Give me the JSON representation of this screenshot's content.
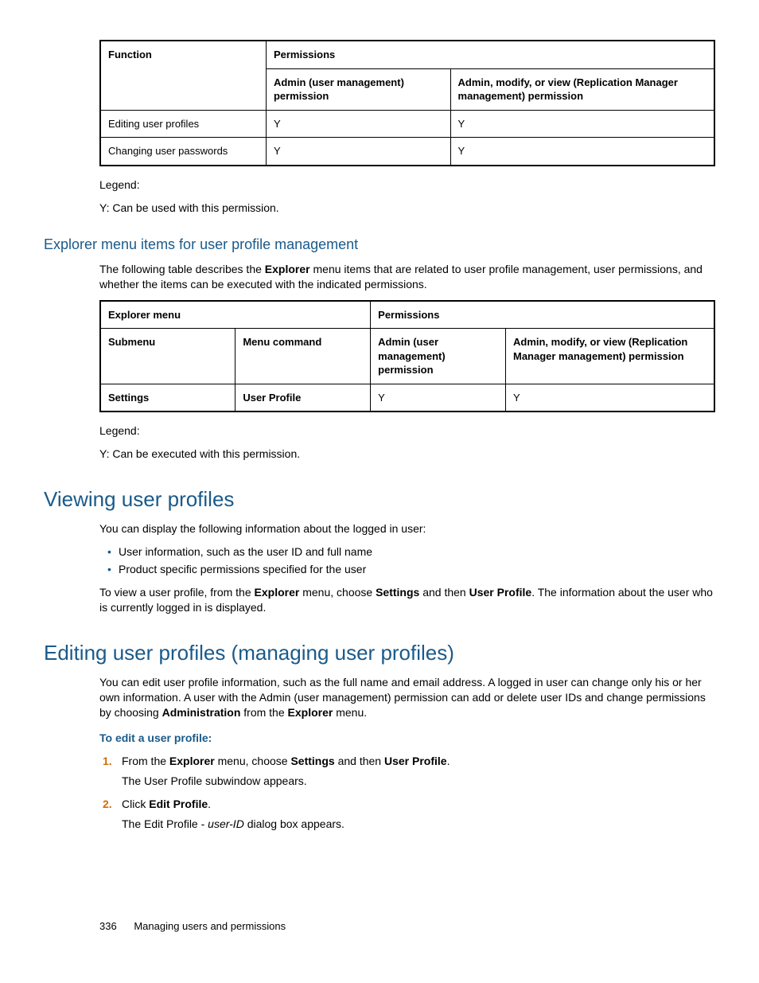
{
  "table1": {
    "h_function": "Function",
    "h_permissions": "Permissions",
    "h_admin_um": "Admin (user management) permission",
    "h_admin_mv": "Admin, modify, or view (Replication Manager management) permission",
    "rows": [
      {
        "fn": "Editing user profiles",
        "c1": "Y",
        "c2": "Y"
      },
      {
        "fn": "Changing user passwords",
        "c1": "Y",
        "c2": "Y"
      }
    ]
  },
  "legend1": {
    "label": "Legend:",
    "line": "Y: Can be used with this permission."
  },
  "section1": {
    "heading": "Explorer menu items for user profile management",
    "intro_pre": "The following table describes the ",
    "intro_bold": "Explorer",
    "intro_post": " menu items that are related to user profile management, user permissions, and whether the items can be executed with the indicated permissions."
  },
  "table2": {
    "h_explorer": "Explorer menu",
    "h_permissions": "Permissions",
    "h_submenu": "Submenu",
    "h_menucmd": "Menu command",
    "h_admin_um": "Admin (user management) permission",
    "h_admin_mv": "Admin, modify, or view (Replication Manager management) permission",
    "rows": [
      {
        "submenu": "Settings",
        "cmd": "User Profile",
        "c1": "Y",
        "c2": "Y"
      }
    ]
  },
  "legend2": {
    "label": "Legend:",
    "line": "Y: Can be executed with this permission."
  },
  "section2": {
    "heading": "Viewing user profiles",
    "intro": "You can display the following information about the logged in user:",
    "bullets": [
      "User information, such as the user ID and full name",
      "Product specific permissions specified for the user"
    ],
    "p2_1": "To view a user profile, from the ",
    "p2_b1": "Explorer",
    "p2_2": " menu, choose ",
    "p2_b2": "Settings",
    "p2_3": " and then ",
    "p2_b3": "User Profile",
    "p2_4": ". The information about the user who is currently logged in is displayed."
  },
  "section3": {
    "heading": "Editing user profiles (managing user profiles)",
    "p1_1": "You can edit user profile information, such as the full name and email address. A logged in user can change only his or her own information. A user with the Admin (user management) permission can add or delete user IDs and change permissions by choosing ",
    "p1_b1": "Administration",
    "p1_2": " from the ",
    "p1_b2": "Explorer",
    "p1_3": " menu.",
    "subhead": "To edit a user profile:",
    "step1_1": "From the ",
    "step1_b1": "Explorer",
    "step1_2": " menu, choose ",
    "step1_b2": "Settings",
    "step1_3": " and then ",
    "step1_b3": "User Profile",
    "step1_4": ".",
    "step1_sub": "The User Profile subwindow appears.",
    "step2_1": "Click ",
    "step2_b1": "Edit Profile",
    "step2_2": ".",
    "step2_sub_1": "The Edit Profile - ",
    "step2_sub_i": "user-ID",
    "step2_sub_2": " dialog box appears."
  },
  "footer": {
    "page": "336",
    "title": "Managing users and permissions"
  }
}
